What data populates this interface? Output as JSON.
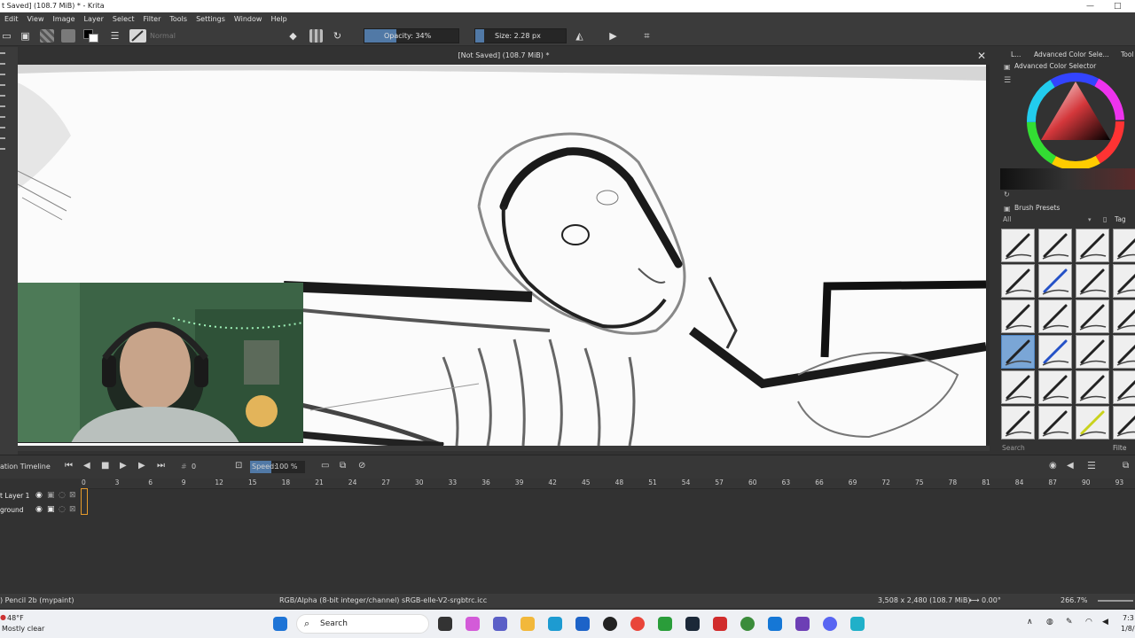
{
  "window": {
    "title": "t Saved]  (108.7 MiB) * - Krita",
    "minimize": "—",
    "maximize": "□"
  },
  "menu": [
    "Edit",
    "View",
    "Image",
    "Layer",
    "Select",
    "Filter",
    "Tools",
    "Settings",
    "Window",
    "Help"
  ],
  "toolbar": {
    "blend_mode": "Normal",
    "opacity_label": "Opacity: 34%",
    "opacity_value": 34,
    "size_label": "Size: 2.28 px",
    "accent": "#5179a6"
  },
  "document": {
    "tab_title": "[Not Saved]  (108.7 MiB) *",
    "close": "✕"
  },
  "dock": {
    "tab_short": "L...",
    "tab_color": "Advanced Color Sele...",
    "tab_tool": "Tool",
    "color_selector_title": "Advanced Color Selector",
    "brush_presets_title": "Brush Presets",
    "filter_all": "All",
    "tag_label": "Tag",
    "search_placeholder": "Search",
    "filter_label": "Filte"
  },
  "timeline": {
    "title": "ation Timeline",
    "frame_field": "0",
    "speed_label": "Speed:",
    "speed_value": "100 %",
    "ruler": [
      "0",
      "3",
      "6",
      "9",
      "12",
      "15",
      "18",
      "21",
      "24",
      "27",
      "30",
      "33",
      "36",
      "39",
      "42",
      "45",
      "48",
      "51",
      "54",
      "57",
      "60",
      "63",
      "66",
      "69",
      "72",
      "75",
      "78",
      "81",
      "84",
      "87",
      "90",
      "93"
    ],
    "layers": [
      {
        "name": "t Layer 1"
      },
      {
        "name": "ground"
      }
    ]
  },
  "status": {
    "brush": ") Pencil 2b (mypaint)",
    "color_space": "RGB/Alpha (8-bit integer/channel)  sRGB-elle-V2-srgbtrc.icc",
    "dimensions": "3,508 x 2,480 (108.7 MiB)",
    "rotation": "0.00°",
    "zoom": "266.7%"
  },
  "taskbar": {
    "weather_temp": "48°F",
    "weather_desc": "Mostly clear",
    "search": "Search",
    "time": "7:3",
    "date": "1/8/"
  }
}
